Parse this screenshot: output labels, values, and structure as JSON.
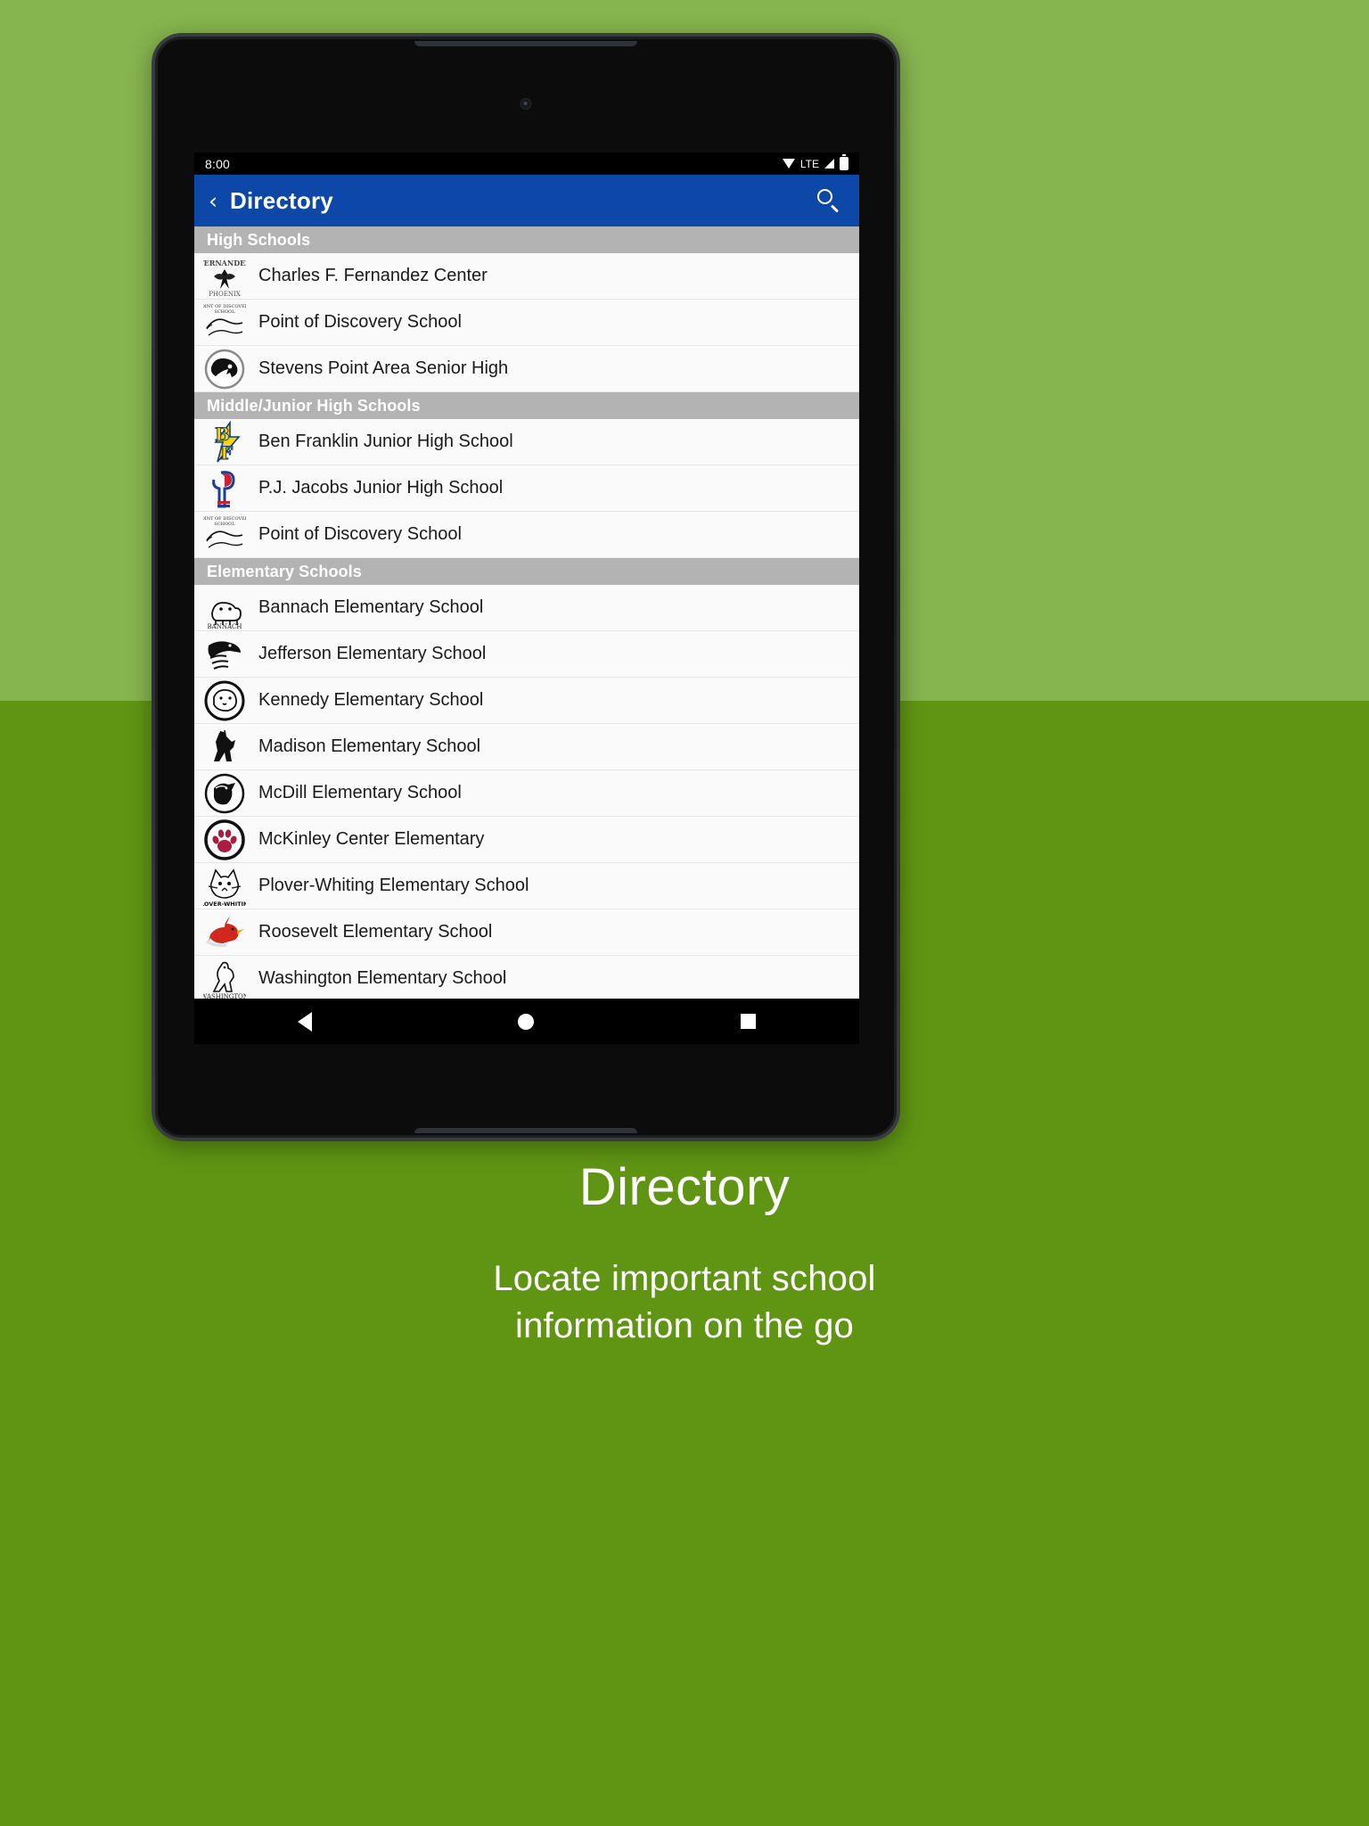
{
  "theme": {
    "promo_bg_top": "#86b44f",
    "promo_bg_bottom": "#5f9513",
    "appbar_color": "#0d47a7",
    "section_header_color": "#b3b3b3",
    "row_bg": "#fafafa"
  },
  "status_bar": {
    "time": "8:00",
    "network_label": "LTE",
    "icons": [
      "wifi-icon",
      "signal-icon",
      "battery-icon"
    ]
  },
  "appbar": {
    "back_icon": "‹",
    "title": "Directory",
    "search_icon": "search-icon"
  },
  "navigation_bar": {
    "back": "nav-back-icon",
    "home": "nav-home-icon",
    "recents": "nav-recents-icon"
  },
  "sections": [
    {
      "header": "High Schools",
      "items": [
        {
          "name": "Charles F. Fernandez Center",
          "logo": "fernandez-phoenix-logo"
        },
        {
          "name": "Point of Discovery School",
          "logo": "point-of-discovery-logo"
        },
        {
          "name": "Stevens Point Area Senior High",
          "logo": "panther-logo"
        }
      ]
    },
    {
      "header": "Middle/Junior High Schools",
      "items": [
        {
          "name": "Ben Franklin Junior High School",
          "logo": "bf-bolt-logo"
        },
        {
          "name": "P.J. Jacobs Junior High School",
          "logo": "pj-flag-logo"
        },
        {
          "name": "Point of Discovery School",
          "logo": "point-of-discovery-logo"
        }
      ]
    },
    {
      "header": "Elementary Schools",
      "items": [
        {
          "name": "Bannach Elementary School",
          "logo": "bannach-bulldog-logo"
        },
        {
          "name": "Jefferson Elementary School",
          "logo": "jefferson-eagle-logo"
        },
        {
          "name": "Kennedy Elementary School",
          "logo": "kennedy-cougar-logo"
        },
        {
          "name": "Madison Elementary School",
          "logo": "madison-mustang-logo"
        },
        {
          "name": "McDill Elementary School",
          "logo": "mcdill-wolf-logo"
        },
        {
          "name": "McKinley Center Elementary",
          "logo": "mckinley-paw-logo"
        },
        {
          "name": "Plover-Whiting Elementary School",
          "logo": "plover-whiting-wildcat-logo"
        },
        {
          "name": "Roosevelt Elementary School",
          "logo": "roosevelt-cardinal-logo"
        },
        {
          "name": "Washington Elementary School",
          "logo": "washington-wildcat-logo"
        }
      ]
    }
  ],
  "caption": {
    "title": "Directory",
    "subtitle": "Locate important school\ninformation on the go"
  }
}
